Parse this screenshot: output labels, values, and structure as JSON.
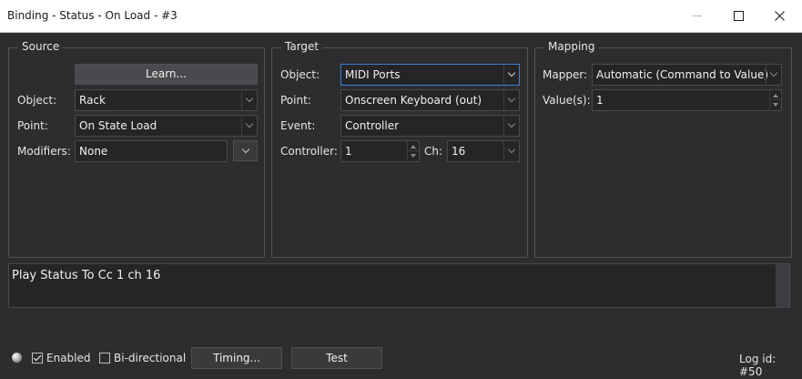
{
  "window": {
    "title": "Binding - Status - On Load - #3"
  },
  "source": {
    "legend": "Source",
    "learn_label": "Learn...",
    "object_label": "Object:",
    "object_value": "Rack",
    "point_label": "Point:",
    "point_value": "On State Load",
    "modifiers_label": "Modifiers:",
    "modifiers_value": "None"
  },
  "target": {
    "legend": "Target",
    "object_label": "Object:",
    "object_value": "MIDI Ports",
    "point_label": "Point:",
    "point_value": "Onscreen Keyboard (out)",
    "event_label": "Event:",
    "event_value": "Controller",
    "controller_label": "Controller:",
    "controller_value": "1",
    "channel_label": "Ch:",
    "channel_value": "16"
  },
  "mapping": {
    "legend": "Mapping",
    "mapper_label": "Mapper:",
    "mapper_value": "Automatic (Command to Value)",
    "values_label": "Value(s):",
    "values_value": "1"
  },
  "description": "Play  Status To Cc 1 ch 16",
  "footer": {
    "enabled_label": "Enabled",
    "enabled_checked": true,
    "bidirectional_label": "Bi-directional",
    "bidirectional_checked": false,
    "timing_label": "Timing...",
    "test_label": "Test",
    "log_id": "Log id: #50"
  },
  "colors": {
    "background": "#2d2d30",
    "field": "#252526",
    "accent_border": "#3d7fd6"
  }
}
